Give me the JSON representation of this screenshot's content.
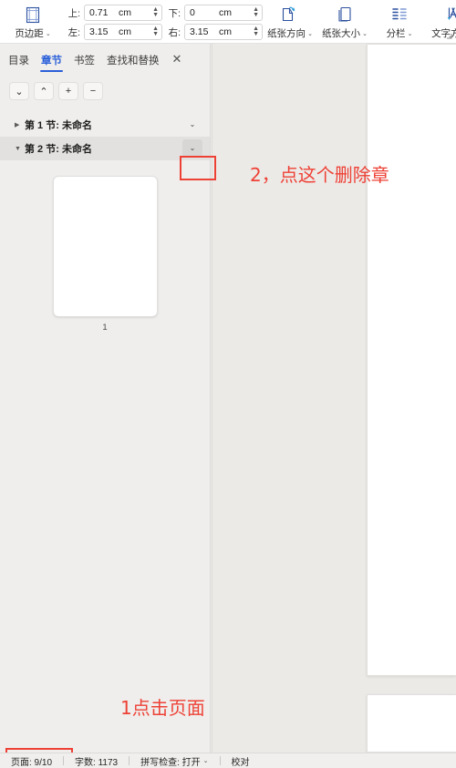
{
  "ribbon": {
    "margins": {
      "label": "页边距",
      "icon": "page-margins-icon",
      "caret": "⌄"
    },
    "fields": [
      {
        "label": "上:",
        "value": "0.71",
        "unit": "cm",
        "name": "margin-top"
      },
      {
        "label": "下:",
        "value": "0",
        "unit": "cm",
        "name": "margin-bottom"
      },
      {
        "label": "左:",
        "value": "3.15",
        "unit": "cm",
        "name": "margin-left"
      },
      {
        "label": "右:",
        "value": "3.15",
        "unit": "cm",
        "name": "margin-right"
      }
    ],
    "buttons": [
      {
        "label": "纸张方向",
        "icon": "page-orientation-icon",
        "caret": "⌄"
      },
      {
        "label": "纸张大小",
        "icon": "page-size-icon",
        "caret": "⌄"
      },
      {
        "label": "分栏",
        "icon": "columns-icon",
        "caret": "⌄"
      },
      {
        "label": "文字方向",
        "icon": "text-direction-icon",
        "caret": "⌄"
      }
    ],
    "dialog_launcher": "⌐"
  },
  "nav": {
    "tabs": [
      {
        "label": "目录",
        "active": false
      },
      {
        "label": "章节",
        "active": true
      },
      {
        "label": "书签",
        "active": false
      },
      {
        "label": "查找和替换",
        "active": false
      }
    ],
    "close_label": "✕",
    "toolbar": [
      {
        "label": "⌄",
        "name": "move-down-button"
      },
      {
        "label": "⌃",
        "name": "move-up-button"
      },
      {
        "label": "+",
        "name": "add-section-button"
      },
      {
        "label": "−",
        "name": "remove-section-button"
      }
    ],
    "sections": [
      {
        "triangle": "▶",
        "name": "第 1 节: 未命名",
        "chevron": "⌄",
        "selected": false
      },
      {
        "triangle": "▼",
        "name": "第 2 节: 未命名",
        "chevron": "⌄",
        "selected": true
      }
    ],
    "thumbnail": {
      "page_number": "1"
    }
  },
  "annotations": {
    "step2": "2，点这个删除章",
    "step1": "1点击页面",
    "accent_color": "#ee4136"
  },
  "statusbar": {
    "page": "页面: 9/10",
    "words": "字数: 1173",
    "spellcheck": "拼写检查: 打开",
    "spellcheck_caret": "⌄",
    "proofread": "校对"
  },
  "colors": {
    "accent_blue": "#2b5fd9",
    "annotation_red": "#ee4136",
    "pane_bg": "#efeeec",
    "canvas_bg": "#eceae7"
  }
}
